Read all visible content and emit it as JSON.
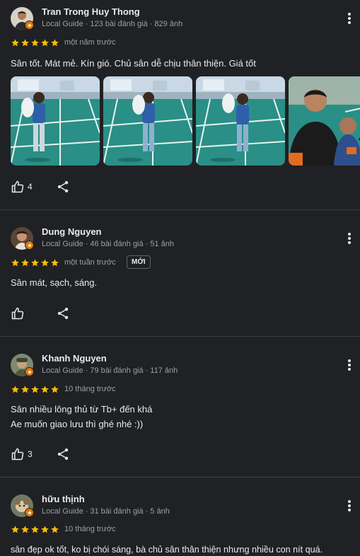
{
  "colors": {
    "background": "#202124",
    "star": "#fbbc04",
    "badge": "#e37400",
    "text_secondary": "#9aa0a6"
  },
  "reviews": [
    {
      "name": "Tran Trong Huy Thong",
      "guide": "Local Guide",
      "review_count": "123 bài đánh giá",
      "photo_count": "829 ảnh",
      "rating": 5,
      "when": "một năm trước",
      "text_lines": [
        "Sân tốt. Mát mẻ. Kín gió. Chủ sân dễ chịu thân thiện. Giá tốt"
      ],
      "likes": "4",
      "photos": [
        "photo-child-court-1",
        "photo-child-court-2",
        "photo-child-court-3",
        "photo-father-and-child"
      ]
    },
    {
      "name": "Dung Nguyen",
      "guide": "Local Guide",
      "review_count": "46 bài đánh giá",
      "photo_count": "51 ảnh",
      "rating": 5,
      "when": "một tuần trước",
      "new_label": "MỚI",
      "text_lines": [
        "Sân mát, sạch, sáng."
      ],
      "likes": ""
    },
    {
      "name": "Khanh Nguyen",
      "guide": "Local Guide",
      "review_count": "79 bài đánh giá",
      "photo_count": "117 ảnh",
      "rating": 5,
      "when": "10 tháng trước",
      "text_lines": [
        "Sân nhiều lông thủ từ Tb+ đến khá",
        "Ae muốn giao lưu thì ghé nhé :))"
      ],
      "likes": "3"
    },
    {
      "name": "hữu thịnh",
      "guide": "Local Guide",
      "review_count": "31 bài đánh giá",
      "photo_count": "5 ảnh",
      "rating": 5,
      "when": "10 tháng trước",
      "text_lines": [
        "sân đẹp ok tốt, ko bị chói sáng, bà chủ sân thân thiện nhưng nhiều con nít quá."
      ]
    }
  ],
  "separator": "·"
}
